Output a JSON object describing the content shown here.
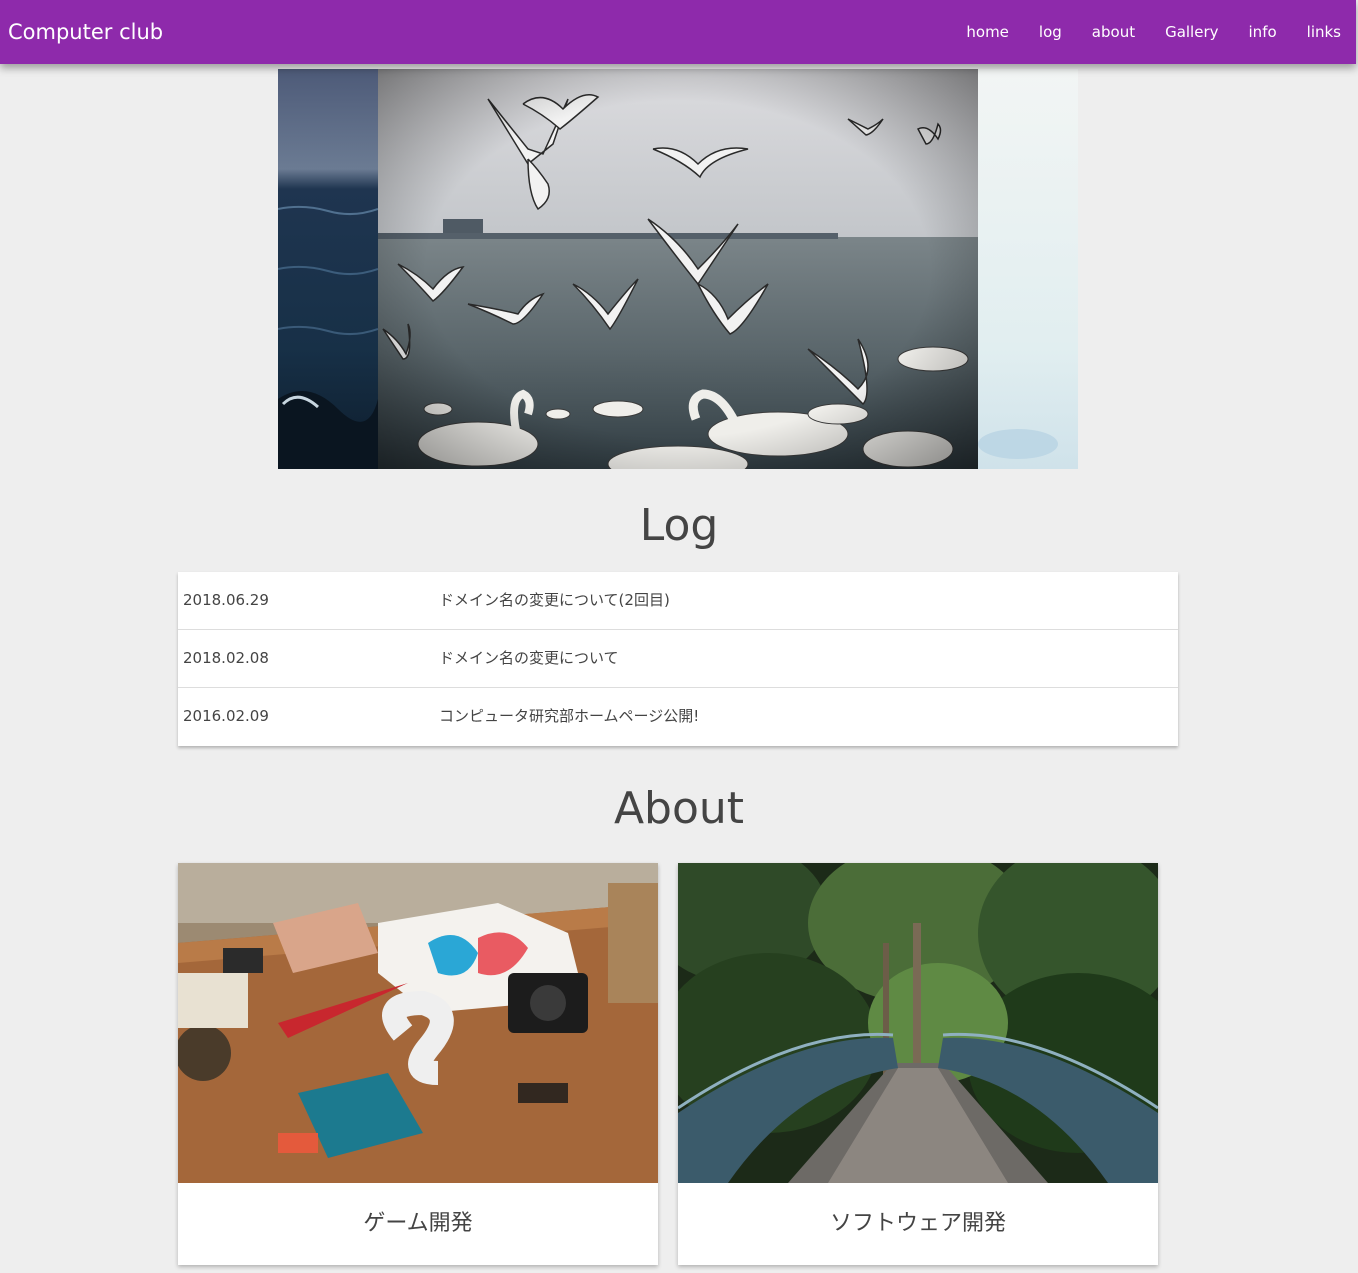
{
  "navbar": {
    "brand": "Computer club",
    "links": [
      "home",
      "log",
      "about",
      "Gallery",
      "info",
      "links"
    ],
    "background": "#8e2aab"
  },
  "log": {
    "title": "Log",
    "entries": [
      {
        "date": "2018.06.29",
        "text": "ドメイン名の変更について(2回目)"
      },
      {
        "date": "2018.02.08",
        "text": "ドメイン名の変更について"
      },
      {
        "date": "2016.02.09",
        "text": "コンピュータ研究部ホームページ公開!"
      }
    ]
  },
  "about": {
    "title": "About",
    "cards": [
      {
        "title": "ゲーム開発"
      },
      {
        "title": "ソフトウェア開発"
      }
    ]
  }
}
